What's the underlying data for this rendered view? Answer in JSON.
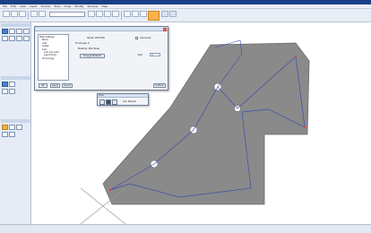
{
  "window": {
    "title": ""
  },
  "menu": {
    "items": [
      "File",
      "Edit",
      "View",
      "Insert",
      "Format",
      "Tools",
      "Draw",
      "Modify",
      "Window",
      "Help"
    ]
  },
  "toolbar": {
    "combo_value": "",
    "hot_icon": "highlight-toolbar-icon"
  },
  "left_panel": {
    "section1": "",
    "section2": "",
    "section3": ""
  },
  "dialog": {
    "title": "",
    "tree": [
      "Plate Settings",
      "Bevel",
      "Inlet",
      "Outlet",
      "Cuts",
      "Link and Lead",
      "Lead Points",
      "Technology"
    ],
    "sheet_label": "Sheet: 200x300",
    "thickness_label": "Thickness: 6",
    "material_label": "Material: Mild Steel",
    "bevel_checkbox": "Use bevel",
    "change_button": "Change Material",
    "angle_label": "Kerf",
    "angle_value": "0",
    "ok_button": "OK",
    "apply_button": "Apply",
    "cancel_button": "Cancel",
    "reset_button": "Default"
  },
  "mini_window": {
    "title": "Tools",
    "label": "Cut: Plasma"
  },
  "status": {
    "cells": [
      "",
      "",
      ""
    ]
  },
  "canvas": {
    "plate_color": "#8a8a8a",
    "path_color": "#3f4ea8",
    "hole_color": "#ffffff",
    "marker_color": "#d44444"
  }
}
